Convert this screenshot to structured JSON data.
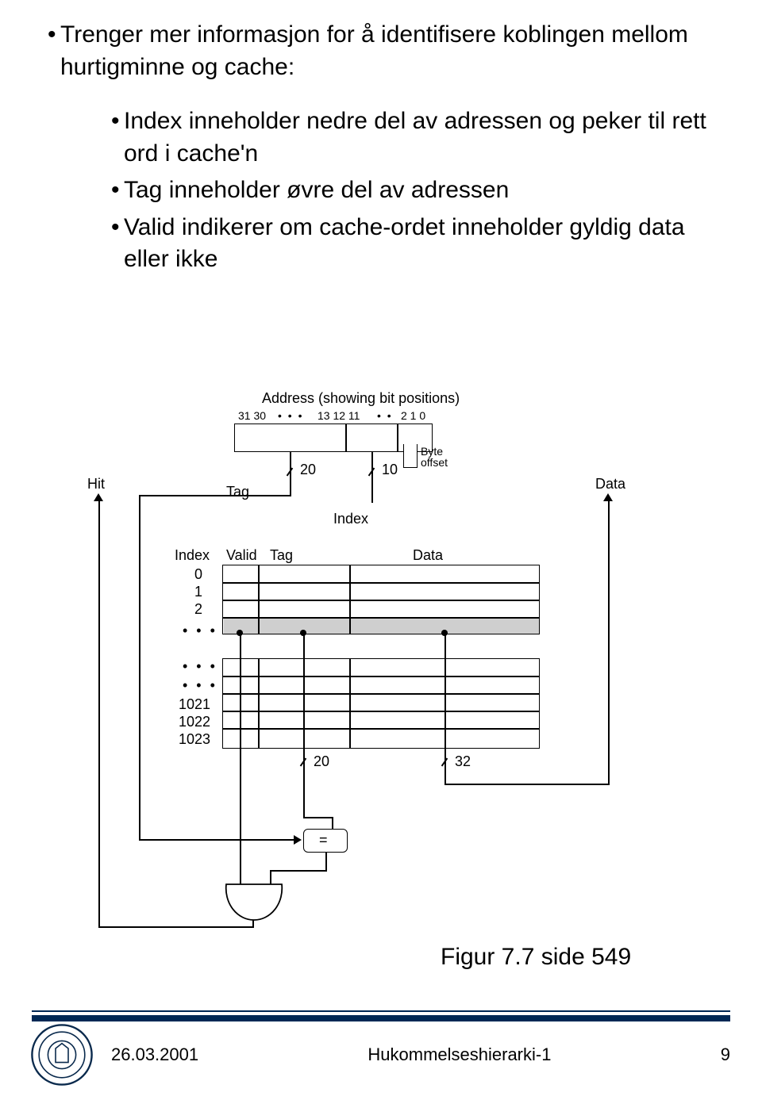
{
  "bullets": {
    "main": "Trenger mer informasjon for å identifisere koblingen mellom hurtigminne og cache:",
    "subs": [
      "Index inneholder nedre del av adressen og peker til rett ord i cache'n",
      "Tag inneholder øvre del av adressen",
      "Valid indikerer om cache-ordet inneholder gyldig data eller ikke"
    ]
  },
  "diagram": {
    "addr_title": "Address (showing bit positions)",
    "bits_left": "31 30",
    "bits_mid": "13 12 11",
    "bits_right": "2 1 0",
    "byte_offset_l1": "Byte",
    "byte_offset_l2": "offset",
    "hit": "Hit",
    "tag": "Tag",
    "index_lbl": "Index",
    "data_lbl": "Data",
    "bw20": "20",
    "bw10": "10",
    "bw32": "32",
    "table_headers": {
      "index": "Index",
      "valid": "Valid",
      "tag": "Tag",
      "data": "Data"
    },
    "idx_top": [
      "0",
      "1",
      "2"
    ],
    "idx_bot": [
      "1021",
      "1022",
      "1023"
    ],
    "eq": "="
  },
  "fignote": "Figur 7.7 side 549",
  "footer": {
    "date": "26.03.2001",
    "center": "Hukommelseshierarki-1",
    "page": "9"
  }
}
